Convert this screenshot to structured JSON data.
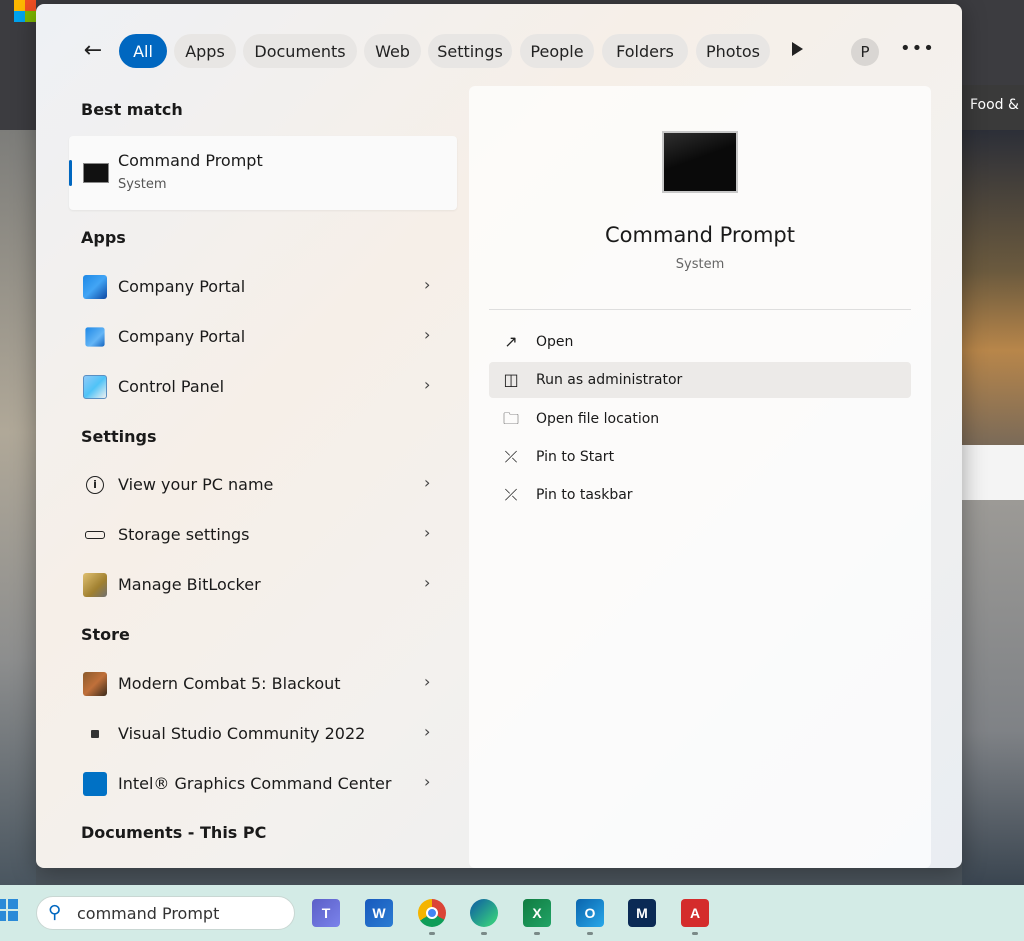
{
  "background": {
    "right_tab_label": "Food & D"
  },
  "filters": {
    "items": [
      {
        "label": "All"
      },
      {
        "label": "Apps"
      },
      {
        "label": "Documents"
      },
      {
        "label": "Web"
      },
      {
        "label": "Settings"
      },
      {
        "label": "People"
      },
      {
        "label": "Folders"
      },
      {
        "label": "Photos"
      }
    ],
    "avatar_initial": "P"
  },
  "best_match": {
    "section": "Best match",
    "title": "Command Prompt",
    "subtitle": "System"
  },
  "apps": {
    "section": "Apps",
    "items": [
      {
        "label": "Company Portal"
      },
      {
        "label": "Company Portal"
      },
      {
        "label": "Control Panel"
      }
    ]
  },
  "settings": {
    "section": "Settings",
    "items": [
      {
        "label": "View your PC name"
      },
      {
        "label": "Storage settings"
      },
      {
        "label": "Manage BitLocker"
      }
    ]
  },
  "store": {
    "section": "Store",
    "items": [
      {
        "label": "Modern Combat 5: Blackout"
      },
      {
        "label": "Visual Studio Community 2022"
      },
      {
        "label": "Intel® Graphics Command Center"
      }
    ]
  },
  "documents": {
    "section": "Documents - This PC"
  },
  "preview": {
    "title": "Command Prompt",
    "subtitle": "System",
    "actions": [
      {
        "label": "Open"
      },
      {
        "label": "Run as administrator"
      },
      {
        "label": "Open file location"
      },
      {
        "label": "Pin to Start"
      },
      {
        "label": "Pin to taskbar"
      }
    ]
  },
  "taskbar": {
    "search_value": "command Prompt"
  },
  "colors": {
    "accent": "#0067c0"
  }
}
